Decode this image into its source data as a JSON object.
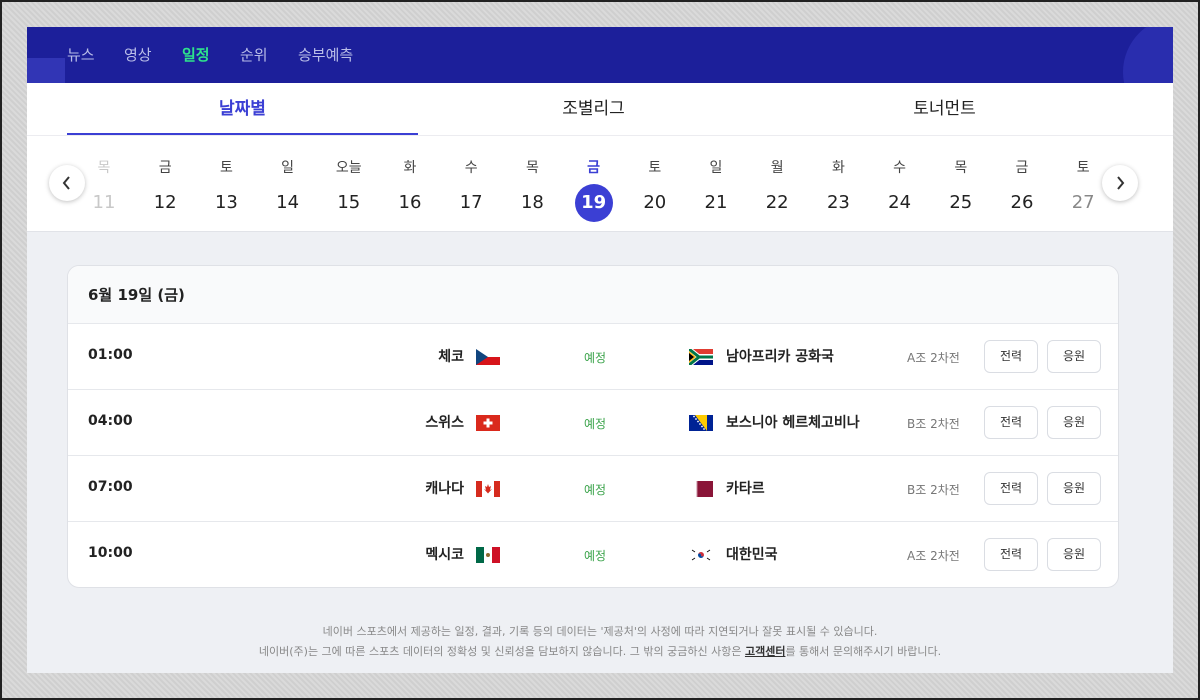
{
  "nav": {
    "items": [
      {
        "label": "뉴스",
        "active": false
      },
      {
        "label": "영상",
        "active": false
      },
      {
        "label": "일정",
        "active": true
      },
      {
        "label": "순위",
        "active": false
      },
      {
        "label": "승부예측",
        "active": false
      }
    ]
  },
  "subtabs": [
    {
      "label": "날짜별",
      "active": true
    },
    {
      "label": "조별리그",
      "active": false
    },
    {
      "label": "토너먼트",
      "active": false
    }
  ],
  "calendar": {
    "days": [
      {
        "dow": "목",
        "num": "11",
        "state": "faded"
      },
      {
        "dow": "금",
        "num": "12",
        "state": ""
      },
      {
        "dow": "토",
        "num": "13",
        "state": ""
      },
      {
        "dow": "일",
        "num": "14",
        "state": ""
      },
      {
        "dow": "오늘",
        "num": "15",
        "state": ""
      },
      {
        "dow": "화",
        "num": "16",
        "state": ""
      },
      {
        "dow": "수",
        "num": "17",
        "state": ""
      },
      {
        "dow": "목",
        "num": "18",
        "state": ""
      },
      {
        "dow": "금",
        "num": "19",
        "state": "selected"
      },
      {
        "dow": "토",
        "num": "20",
        "state": ""
      },
      {
        "dow": "일",
        "num": "21",
        "state": ""
      },
      {
        "dow": "월",
        "num": "22",
        "state": ""
      },
      {
        "dow": "화",
        "num": "23",
        "state": ""
      },
      {
        "dow": "수",
        "num": "24",
        "state": ""
      },
      {
        "dow": "목",
        "num": "25",
        "state": ""
      },
      {
        "dow": "금",
        "num": "26",
        "state": ""
      },
      {
        "dow": "토",
        "num": "27",
        "state": "faded-r"
      }
    ]
  },
  "schedule": {
    "date_heading": "6월 19일 (금)",
    "matches": [
      {
        "time": "01:00",
        "home": "체코",
        "home_flag": "czech-flag",
        "status": "예정",
        "away": "남아프리카 공화국",
        "away_flag": "south-africa-flag",
        "group": "A조 2차전",
        "record_label": "전력",
        "cheer_label": "응원"
      },
      {
        "time": "04:00",
        "home": "스위스",
        "home_flag": "switzerland-flag",
        "status": "예정",
        "away": "보스니아 헤르체고비나",
        "away_flag": "bosnia-flag",
        "group": "B조 2차전",
        "record_label": "전력",
        "cheer_label": "응원"
      },
      {
        "time": "07:00",
        "home": "캐나다",
        "home_flag": "canada-flag",
        "status": "예정",
        "away": "카타르",
        "away_flag": "qatar-flag",
        "group": "B조 2차전",
        "record_label": "전력",
        "cheer_label": "응원"
      },
      {
        "time": "10:00",
        "home": "멕시코",
        "home_flag": "mexico-flag",
        "status": "예정",
        "away": "대한민국",
        "away_flag": "korea-flag",
        "group": "A조 2차전",
        "record_label": "전력",
        "cheer_label": "응원"
      }
    ]
  },
  "footer": {
    "line1": "네이버 스포츠에서 제공하는 일정, 결과, 기록 등의 데이터는 '제공처'의 사정에 따라 지연되거나 잘못 표시될 수 있습니다.",
    "line2_before": "네이버(주)는 그에 따른 스포츠 데이터의 정확성 및 신뢰성을 담보하지 않습니다. 그 밖의 궁금하신 사항은 ",
    "line2_link": "고객센터",
    "line2_after": "를 통해서 문의해주시기 바랍니다."
  },
  "colors": {
    "nav_bg": "#1c1f9a",
    "nav_active": "#2ee28c",
    "accent": "#3b3fd4",
    "status_green": "#3aa34a"
  }
}
